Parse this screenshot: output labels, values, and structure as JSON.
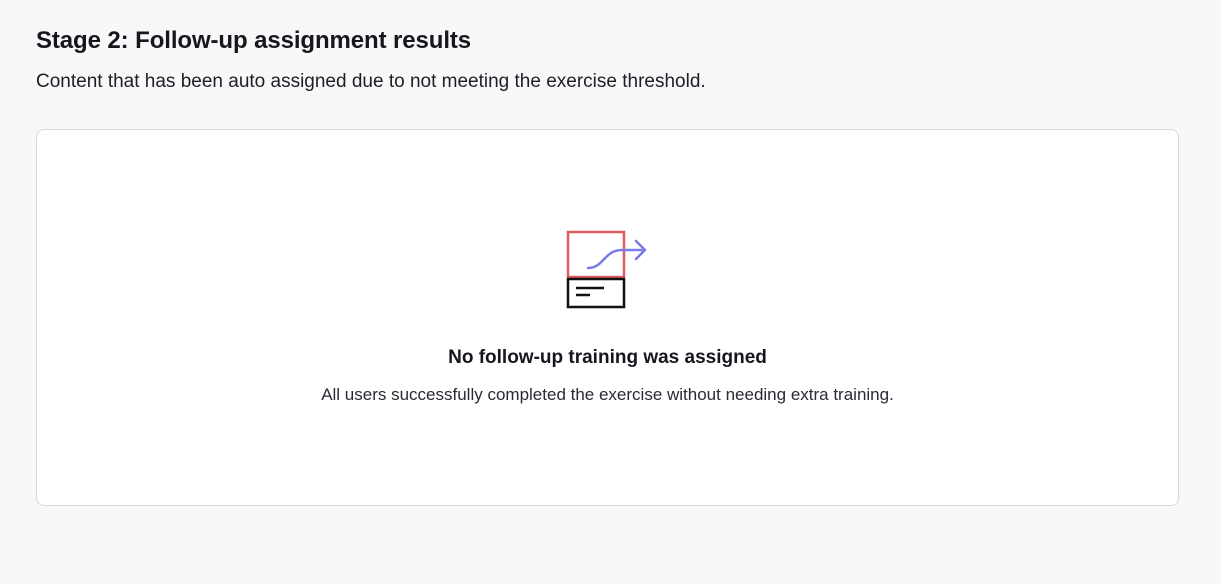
{
  "stage": {
    "title": "Stage 2: Follow-up assignment results",
    "description": "Content that has been auto assigned due to not meeting the exercise threshold."
  },
  "empty_state": {
    "icon": "assignment-arrow-icon",
    "title": "No follow-up training was assigned",
    "description": "All users successfully completed the exercise without needing extra training."
  },
  "colors": {
    "background": "#f8f8f8",
    "card_background": "#ffffff",
    "card_border": "#d8d8dc",
    "icon_box_red": "#e05a63",
    "icon_arrow_purple": "#7b7be8",
    "icon_box_dark": "#111111"
  }
}
